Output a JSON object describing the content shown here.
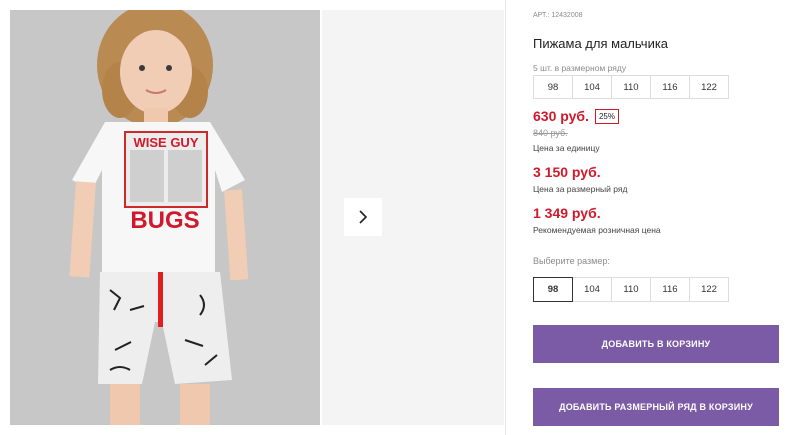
{
  "gallery": {
    "next_icon": "chevron-right-icon",
    "shirt_print_top": "WISE GUY",
    "shirt_print_main": "BUGS"
  },
  "product": {
    "sku": "АРТ.: 12432008",
    "title": "Пижама для мальчика",
    "pack_label": "5 шт. в размерном ряду",
    "pack_sizes": [
      "98",
      "104",
      "110",
      "116",
      "122"
    ],
    "price": "630 руб.",
    "discount": "25%",
    "old_price": "840 руб.",
    "unit_price_caption": "Цена за единицу",
    "pack_price": "3 150 руб.",
    "pack_price_caption": "Цена за размерный ряд",
    "retail_price": "1 349 руб.",
    "retail_price_caption": "Рекомендуемая розничная цена",
    "choose_size_label": "Выберите размер:",
    "select_sizes": [
      "98",
      "104",
      "110",
      "116",
      "122"
    ],
    "selected_size": "98"
  },
  "actions": {
    "add_to_cart": "ДОБАВИТЬ В КОРЗИНУ",
    "add_pack_to_cart": "ДОБАВИТЬ РАЗМЕРНЫЙ РЯД В КОРЗИНУ"
  },
  "colors": {
    "accent": "#7b5aa6",
    "price_red": "#d0192b"
  }
}
